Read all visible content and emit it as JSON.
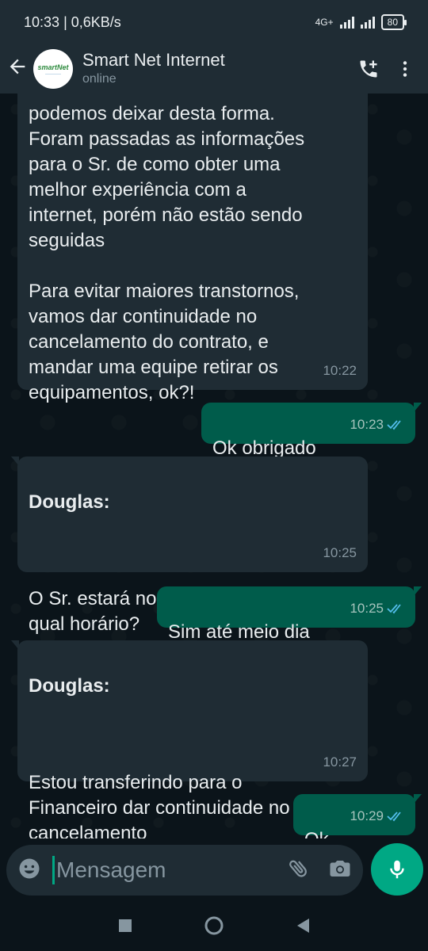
{
  "status_bar": {
    "time": "10:33",
    "speed": "0,6KB/s",
    "network": "4G+",
    "battery": "80"
  },
  "header": {
    "name": "Smart Net Internet",
    "status": "online",
    "logo_text": "smartNet"
  },
  "messages": [
    {
      "text": "podemos deixar desta forma.\nForam passadas as informações\npara o Sr. de como obter uma\nmelhor experiência com a\ninternet, porém não estão sendo\nseguidas\n\nPara evitar maiores transtornos,\nvamos dar continuidade no\ncancelamento do contrato, e\nmandar uma equipe retirar os\nequipamentos, ok?!",
      "time": "10:22"
    },
    {
      "text": "Ok obrigado",
      "time": "10:23"
    },
    {
      "sender": "Douglas:",
      "text": "O Sr. estará no local hoje? Até\nqual horário?",
      "time": "10:25"
    },
    {
      "text": "Sim até meio dia",
      "time": "10:25"
    },
    {
      "sender": "Douglas:",
      "text": "Estou transferindo para o\nFinanceiro dar continuidade no\ncancelamento",
      "time": "10:27"
    },
    {
      "text": "Ok",
      "time": "10:29"
    }
  ],
  "composer": {
    "placeholder": "Mensagem"
  },
  "colors": {
    "incoming": "#1f2c34",
    "outgoing": "#005c4b",
    "accent": "#00a884",
    "read_ticks": "#53bdeb"
  },
  "icons": [
    "back-arrow-icon",
    "add-call-icon",
    "more-vert-icon",
    "emoji-icon",
    "attach-icon",
    "camera-icon",
    "mic-icon",
    "double-check-icon"
  ]
}
